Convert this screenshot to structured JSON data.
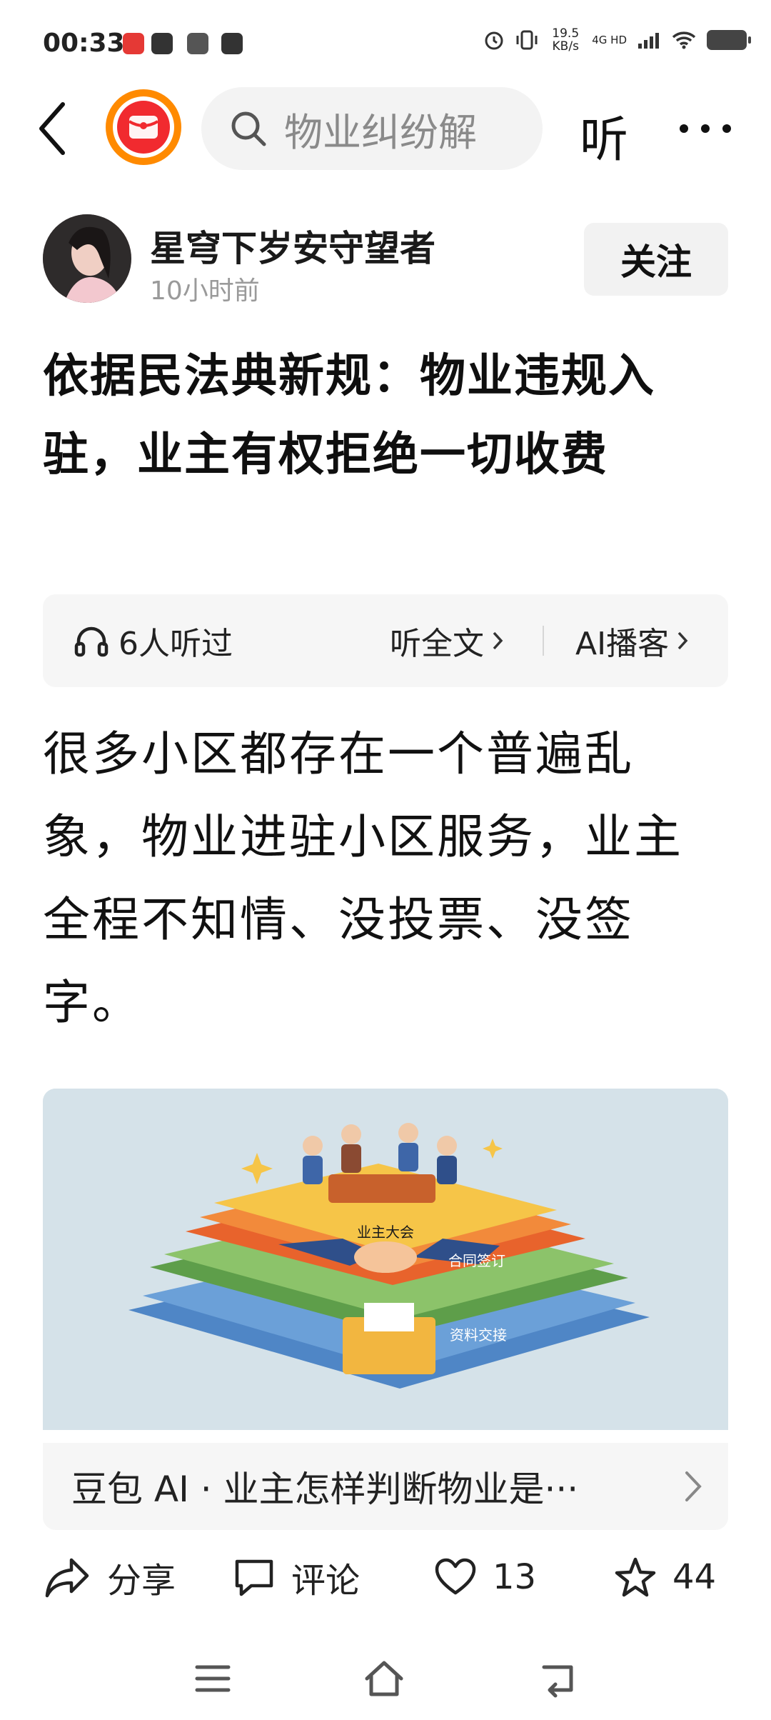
{
  "status_bar": {
    "time": "00:33",
    "network_speed": "19.5 KB/s",
    "network_type": "4G HD"
  },
  "top_nav": {
    "search_placeholder": "物业纠纷解",
    "listen_label": "听"
  },
  "author": {
    "name": "星穹下岁安守望者",
    "time_ago": "10小时前",
    "follow_label": "关注"
  },
  "article": {
    "title": "依据民法典新规：物业违规入驻，业主有权拒绝一切收费",
    "body": "很多小区都存在一个普遍乱象，物业进驻小区服务，业主全程不知情、没投票、没签字。",
    "image_labels": {
      "layer1": "业主大会",
      "layer2": "合同签订",
      "layer3": "资料交接"
    }
  },
  "audio_bar": {
    "listeners": "6人听过",
    "listen_full": "听全文",
    "ai_podcast": "AI播客"
  },
  "ai_card": {
    "text": "豆包 AI · 业主怎样判断物业是···"
  },
  "actions": {
    "share": "分享",
    "comment": "评论",
    "likes": "13",
    "favorites": "44"
  },
  "colors": {
    "accent_orange": "#ff8a00",
    "accent_red": "#f12a2f",
    "text_primary": "#111111",
    "text_secondary": "#9a9a9a",
    "card_bg": "#f6f6f6"
  }
}
